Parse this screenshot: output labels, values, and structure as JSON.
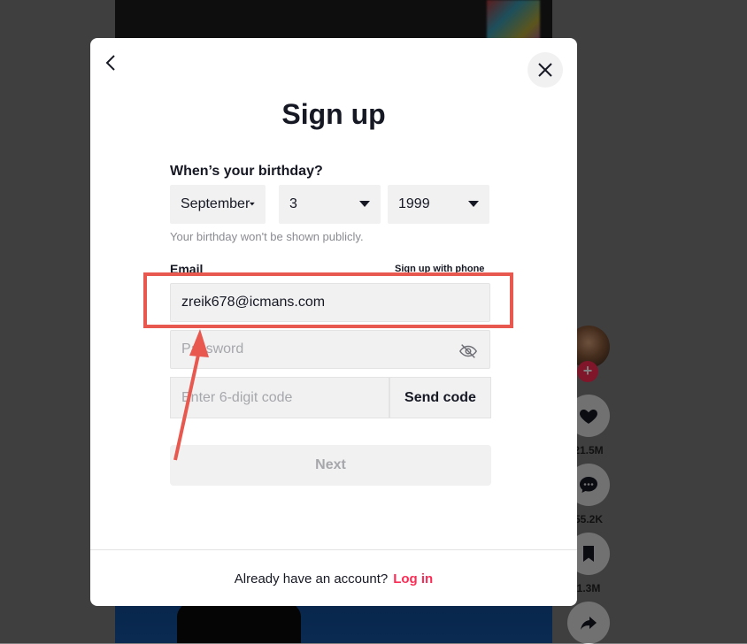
{
  "modal": {
    "title": "Sign up",
    "birthday_label": "When’s your birthday?",
    "month": "September",
    "day": "3",
    "year": "1999",
    "birthday_hint": "Your birthday won't be shown publicly.",
    "email_label": "Email",
    "phone_link": "Sign up with phone",
    "email_value": "zreik678@icmans.com",
    "password_placeholder": "Password",
    "code_placeholder": "Enter 6-digit code",
    "send_code": "Send code",
    "next": "Next",
    "footer_text": "Already have an account?",
    "login_link": "Log in"
  },
  "sidebar": {
    "likes": "21.5M",
    "comments": "55.2K",
    "saves": "1.3M"
  },
  "colors": {
    "accent": "#fe2c55",
    "highlight": "#e8584f"
  }
}
